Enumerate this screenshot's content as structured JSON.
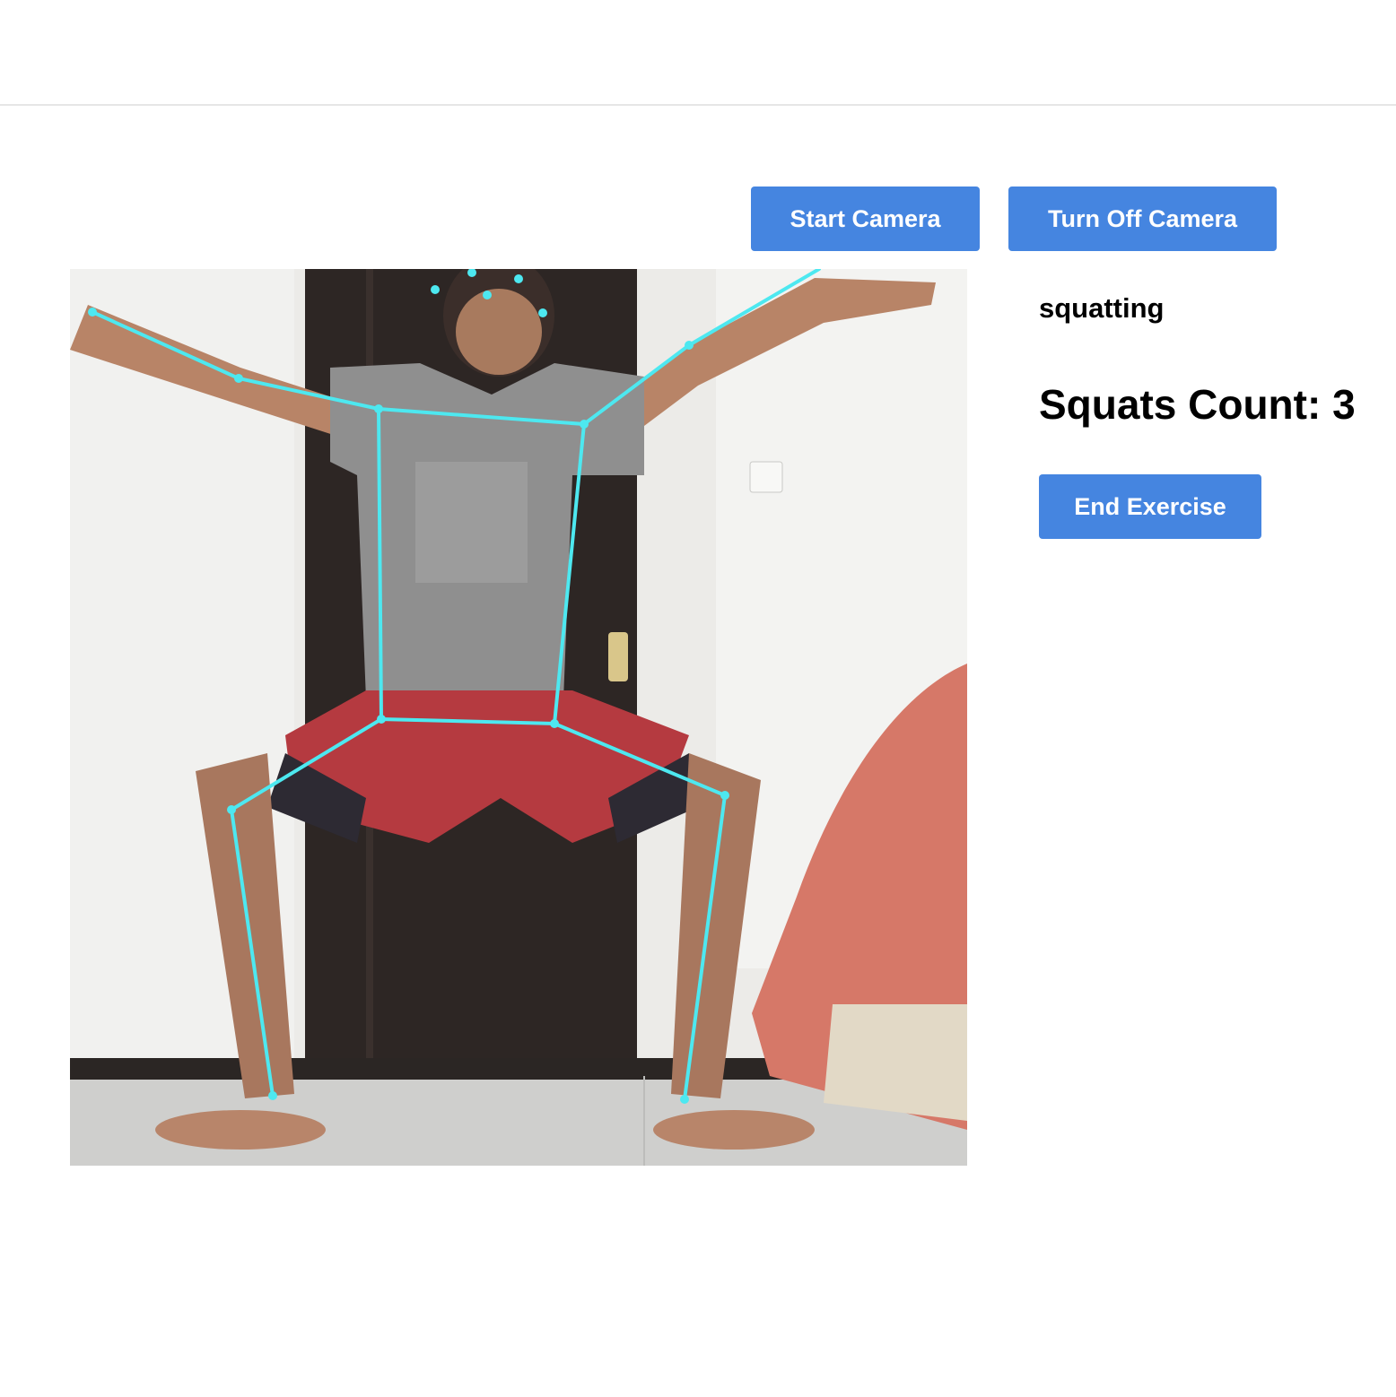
{
  "controls": {
    "start_camera_label": "Start Camera",
    "turn_off_camera_label": "Turn Off Camera",
    "end_exercise_label": "End Exercise"
  },
  "pose": {
    "status": "squatting",
    "count_label": "Squats Count: 3"
  },
  "overlay": {
    "skeleton_color": "#4de8f0"
  },
  "button_color": "#4585e0"
}
